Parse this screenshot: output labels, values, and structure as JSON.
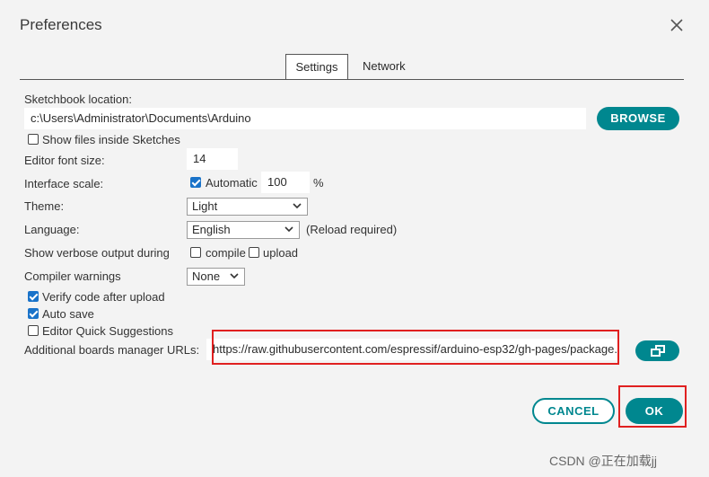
{
  "dialog": {
    "title": "Preferences"
  },
  "tabs": [
    {
      "label": "Settings",
      "active": true
    },
    {
      "label": "Network",
      "active": false
    }
  ],
  "sketchbook": {
    "label": "Sketchbook location:",
    "value": "c:\\Users\\Administrator\\Documents\\Arduino",
    "browse_label": "BROWSE"
  },
  "show_files": {
    "label": "Show files inside Sketches",
    "checked": false
  },
  "font_size": {
    "label": "Editor font size:",
    "value": "14"
  },
  "scale": {
    "label": "Interface scale:",
    "automatic_label": "Automatic",
    "automatic_checked": true,
    "value": "100",
    "unit": "%"
  },
  "theme": {
    "label": "Theme:",
    "value": "Light"
  },
  "language": {
    "label": "Language:",
    "value": "English",
    "note": "(Reload required)"
  },
  "verbose": {
    "label": "Show verbose output during",
    "compile_label": "compile",
    "compile_checked": false,
    "upload_label": "upload",
    "upload_checked": false
  },
  "warnings": {
    "label": "Compiler warnings",
    "value": "None"
  },
  "verify": {
    "label": "Verify code after upload",
    "checked": true
  },
  "autosave": {
    "label": "Auto save",
    "checked": true
  },
  "quick_suggestions": {
    "label": "Editor Quick Suggestions",
    "checked": false
  },
  "boards_urls": {
    "label": "Additional boards manager URLs:",
    "value": "https://raw.githubusercontent.com/espressif/arduino-esp32/gh-pages/package..."
  },
  "footer": {
    "cancel_label": "CANCEL",
    "ok_label": "OK"
  },
  "watermark": "CSDN @正在加载jj",
  "colors": {
    "accent": "#00878f",
    "highlight": "#e02020",
    "checkbox": "#1a73c9"
  },
  "icons": {
    "close": "close-icon",
    "edit_list": "open-window-icon",
    "select": "chevron-down-icon"
  }
}
